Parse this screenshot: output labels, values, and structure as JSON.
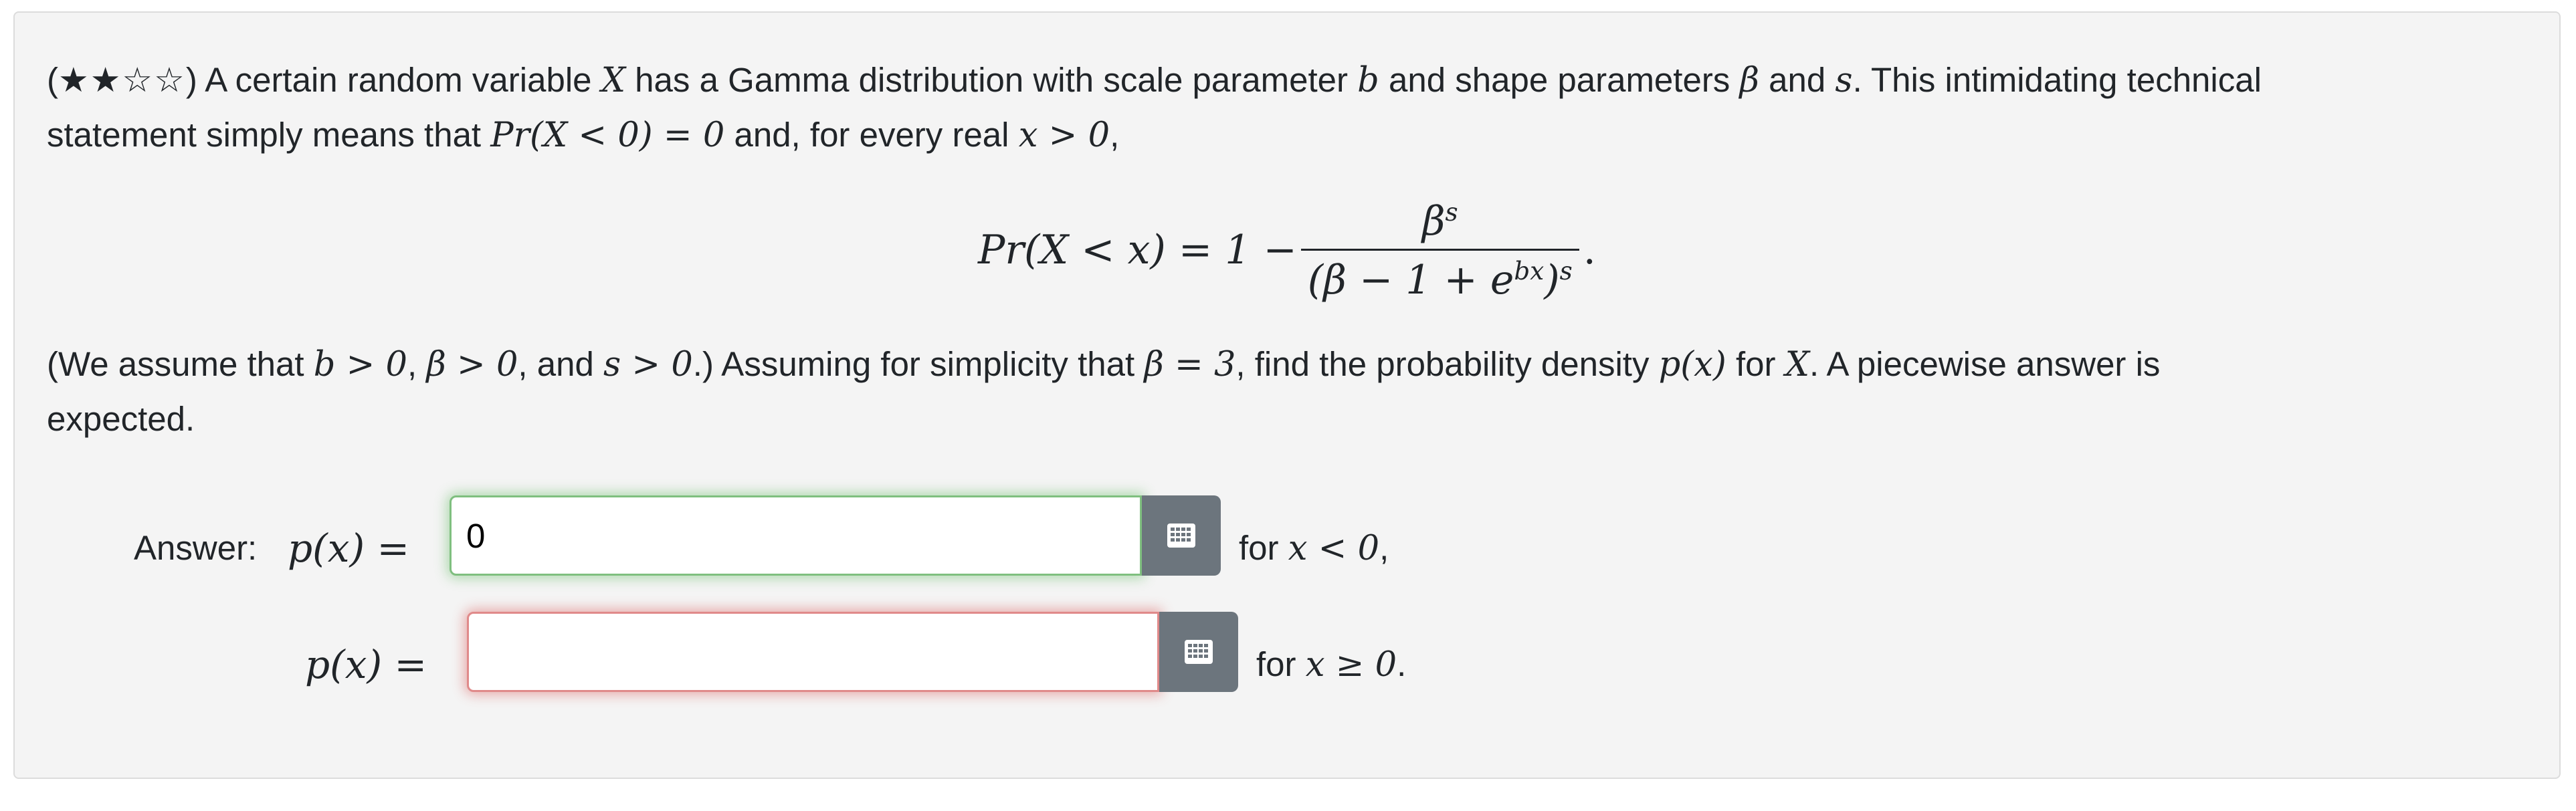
{
  "problem": {
    "difficulty_stars": "★★☆☆",
    "intro_a": ") A certain random variable ",
    "var_X": "X",
    "intro_b": " has a Gamma distribution with scale parameter ",
    "var_b": "b",
    "intro_c": " and shape parameters ",
    "var_beta": "β",
    "intro_d": " and ",
    "var_s": "s",
    "intro_e": ". This intimidating technical",
    "line2_a": "statement simply means that ",
    "line2_math1": "Pr(X < 0) = 0",
    "line2_b": " and, for every real ",
    "line2_math2": "x > 0",
    "line2_c": ",",
    "eq_lhs": "Pr(X < x) = 1 −",
    "eq_num_base": "β",
    "eq_num_exp": "s",
    "eq_den_base": "(β − 1 + e",
    "eq_den_exp1": "bx",
    "eq_den_close": ")",
    "eq_den_exp2": "s",
    "eq_end": ".",
    "para2_a": "(We assume that ",
    "para2_m1": "b > 0",
    "para2_sep1": ", ",
    "para2_m2": "β > 0",
    "para2_sep2": ", and ",
    "para2_m3": "s > 0",
    "para2_b": ".) Assuming for simplicity that ",
    "para2_m4": "β = 3",
    "para2_c": ", find the probability density ",
    "para2_m5": "p(x)",
    "para2_d": " for ",
    "para2_m6": "X",
    "para2_e": ". A piecewise answer is",
    "para2_line2": "expected."
  },
  "answer": {
    "label": "Answer:",
    "row1": {
      "lhs": "p(x) =",
      "value": "0",
      "condition_prefix": "for ",
      "condition_math": "x < 0",
      "condition_suffix": ","
    },
    "row2": {
      "lhs": "p(x) =",
      "value": "",
      "condition_prefix": "for ",
      "condition_math": "x ≥ 0",
      "condition_suffix": "."
    },
    "keyboard_icon": "keyboard-grid-icon"
  },
  "colors": {
    "card_bg": "#f4f4f4",
    "button_bg": "#6c757d",
    "valid": "#5cb85c",
    "invalid": "#d9534f"
  }
}
